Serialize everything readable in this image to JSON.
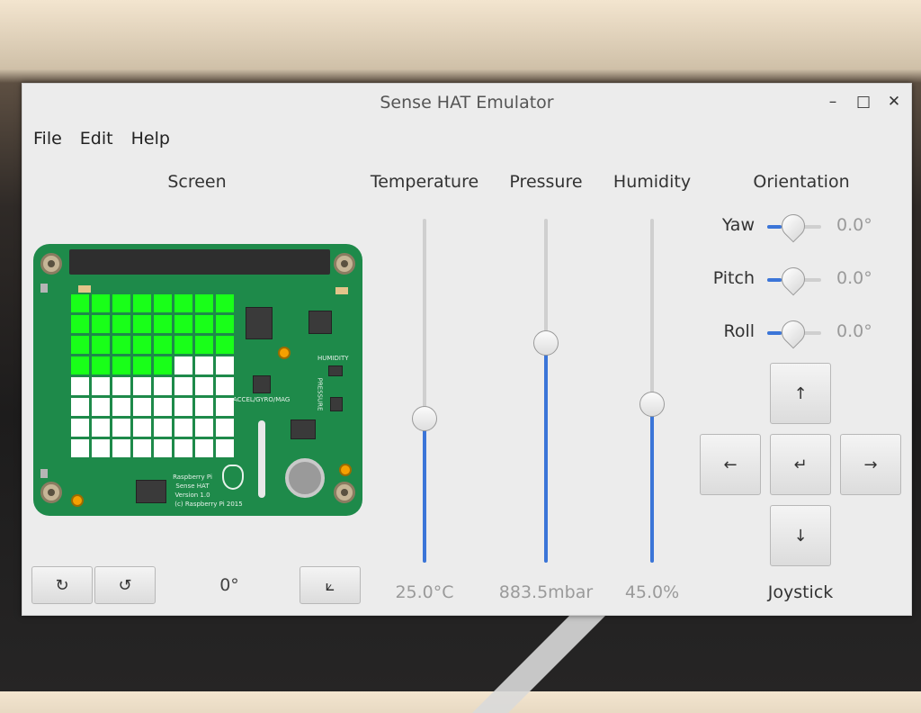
{
  "window": {
    "title": "Sense HAT Emulator"
  },
  "window_controls": {
    "minimize": "–",
    "maximize": "□",
    "close": "✕"
  },
  "menu": [
    "File",
    "Edit",
    "Help"
  ],
  "screen": {
    "title": "Screen",
    "led_matrix_lit": [
      8,
      8,
      8,
      5,
      0,
      0,
      0,
      0
    ],
    "lit_color": "#19ff19",
    "board_text": {
      "humidity": "HUMIDITY",
      "pressure": "PRESSURE",
      "accel": "ACCEL/GYRO/MAG",
      "line1": "Raspberry Pi",
      "line2": "Sense HAT",
      "line3": "Version 1.0",
      "line4": "(c) Raspberry Pi 2015"
    },
    "rotate_cw_icon": "↻",
    "rotate_ccw_icon": "↺",
    "rotation": "0°",
    "flip_icon": "⟀"
  },
  "sensors": {
    "temperature": {
      "title": "Temperature",
      "value": "25.0°C",
      "level": 0.42
    },
    "pressure": {
      "title": "Pressure",
      "value": "883.5mbar",
      "level": 0.64
    },
    "humidity": {
      "title": "Humidity",
      "value": "45.0%",
      "level": 0.46
    }
  },
  "orientation": {
    "title": "Orientation",
    "yaw": {
      "label": "Yaw",
      "value": "0.0°"
    },
    "pitch": {
      "label": "Pitch",
      "value": "0.0°"
    },
    "roll": {
      "label": "Roll",
      "value": "0.0°"
    }
  },
  "joystick": {
    "label": "Joystick",
    "up": "↑",
    "left": "←",
    "enter": "↵",
    "right": "→",
    "down": "↓"
  },
  "colors": {
    "accent": "#3b75d8",
    "board": "#1e8a4a"
  }
}
